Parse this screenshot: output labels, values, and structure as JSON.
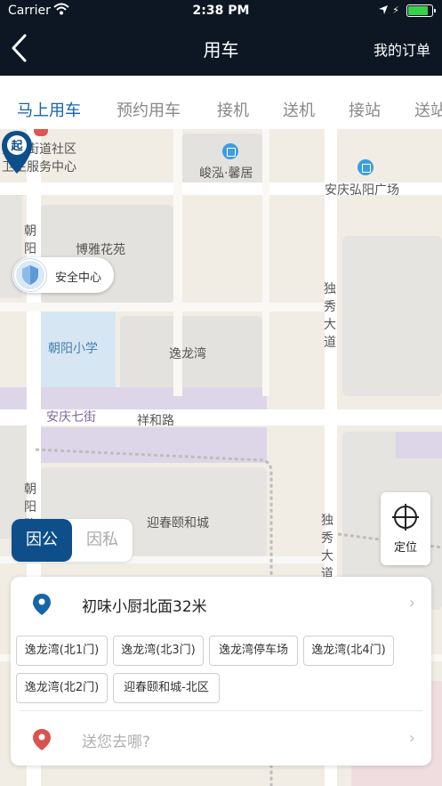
{
  "status_bar": {
    "carrier": "Carrier",
    "time": "2:38 PM"
  },
  "nav": {
    "title": "用车",
    "right_action": "我的订单"
  },
  "tabs": [
    "马上用车",
    "预约用车",
    "接机",
    "送机",
    "接站",
    "送站"
  ],
  "active_tab": 0,
  "map": {
    "labels": {
      "community_center_1": "大桥街道社区",
      "community_center_2": "卫生服务中心",
      "junhong": "峻泓·馨居",
      "hongyang_plaza": "安庆弘阳广场",
      "chaoyang_road_top": "朝阳",
      "boya": "博雅花苑",
      "chaoyang_school": "朝阳小学",
      "yilongwan": "逸龙湾",
      "duxiu_top": "独秀大道",
      "anqing_7th": "安庆七街",
      "xianghe_road": "祥和路",
      "chaoyang_road_bottom": "朝阳路",
      "yingchun": "迎春颐和城",
      "duxiu_bottom": "独秀大道"
    },
    "safety_center": "安全中心",
    "start_pin_label": "起",
    "locate_label": "定位"
  },
  "toggle": {
    "public": "因公",
    "private": "因私"
  },
  "trip": {
    "pickup": "初味小厨北面32米",
    "suggestions": [
      "逸龙湾(北1门)",
      "逸龙湾(北3门)",
      "逸龙湾停车场",
      "逸龙湾(北4门)",
      "逸龙湾(北2门)",
      "迎春颐和城-北区"
    ],
    "destination_placeholder": "送您去哪?"
  },
  "colors": {
    "header_bg": "#0c1723",
    "accent": "#1565a8",
    "toggle_active": "#0e4f8a",
    "dest_pin": "#d9534f"
  }
}
